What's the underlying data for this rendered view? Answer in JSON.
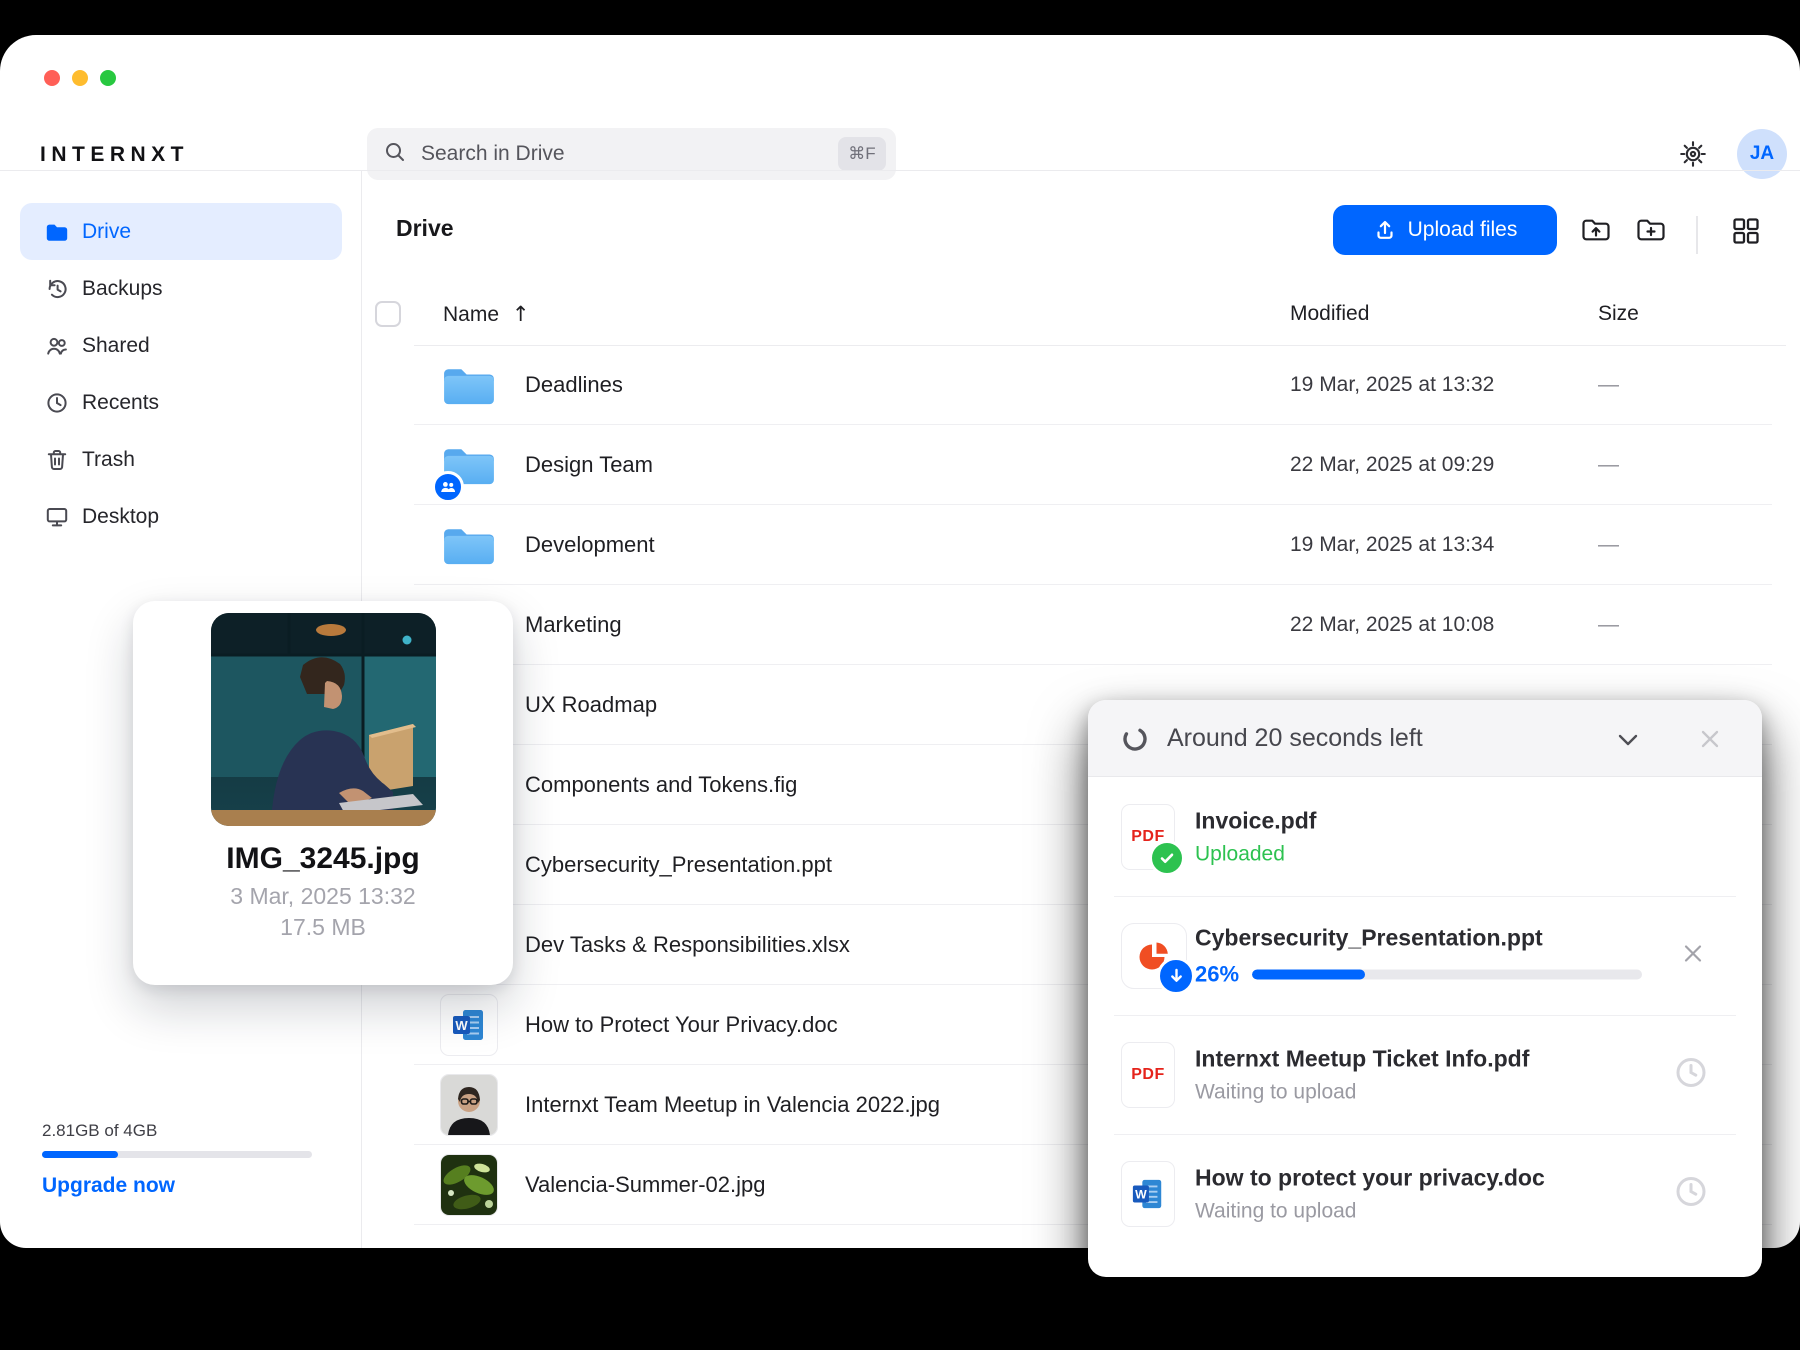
{
  "brand": {
    "logo_text": "INTERNXT"
  },
  "topbar": {
    "search_placeholder": "Search in Drive",
    "search_shortcut": "⌘F",
    "avatar_initials": "JA"
  },
  "sidebar": {
    "items": [
      {
        "label": "Drive",
        "active": true
      },
      {
        "label": "Backups",
        "active": false
      },
      {
        "label": "Shared",
        "active": false
      },
      {
        "label": "Recents",
        "active": false
      },
      {
        "label": "Trash",
        "active": false
      },
      {
        "label": "Desktop",
        "active": false
      }
    ],
    "storage": {
      "usage_text": "2.81GB of 4GB",
      "used_percent": 28,
      "upgrade_label": "Upgrade now"
    }
  },
  "content": {
    "title": "Drive",
    "upload_button_label": "Upload files",
    "table": {
      "col_name": "Name",
      "sort_indicator": "↑",
      "col_modified": "Modified",
      "col_size": "Size",
      "rows": [
        {
          "name": "Deadlines",
          "type": "folder",
          "modified": "19 Mar, 2025 at 13:32",
          "size": "—"
        },
        {
          "name": "Design Team",
          "type": "folder-shared",
          "modified": "22 Mar, 2025 at 09:29",
          "size": "—"
        },
        {
          "name": "Development",
          "type": "folder",
          "modified": "19 Mar, 2025 at 13:34",
          "size": "—"
        },
        {
          "name": "Marketing",
          "type": "folder",
          "modified": "22 Mar, 2025 at 10:08",
          "size": "—"
        },
        {
          "name": "UX Roadmap",
          "type": "folder"
        },
        {
          "name": "Components and Tokens.fig",
          "type": "file"
        },
        {
          "name": "Cybersecurity_Presentation.ppt",
          "type": "ppt"
        },
        {
          "name": "Dev Tasks & Responsibilities.xlsx",
          "type": "xlsx"
        },
        {
          "name": "How to Protect Your Privacy.doc",
          "type": "word"
        },
        {
          "name": "Internxt Team Meetup in Valencia 2022.jpg",
          "type": "image"
        },
        {
          "name": "Valencia-Summer-02.jpg",
          "type": "image"
        }
      ]
    }
  },
  "preview_card": {
    "filename": "IMG_3245.jpg",
    "date": "3 Mar, 2025 13:32",
    "size": "17.5 MB"
  },
  "upload_panel": {
    "title": "Around 20 seconds left",
    "items": [
      {
        "name": "Invoice.pdf",
        "type": "pdf",
        "status": "Uploaded",
        "state": "done"
      },
      {
        "name": "Cybersecurity_Presentation.ppt",
        "type": "ppt",
        "percent_label": "26%",
        "progress_percent": 29,
        "state": "uploading"
      },
      {
        "name": "Internxt Meetup Ticket Info.pdf",
        "type": "pdf",
        "status": "Waiting to upload",
        "state": "waiting"
      },
      {
        "name": "How to protect your privacy.doc",
        "type": "word",
        "status": "Waiting to upload",
        "state": "waiting"
      }
    ]
  },
  "colors": {
    "accent_blue": "#0066FF",
    "success_green": "#2DC250",
    "pdf_red": "#E5231B",
    "ppt_orange": "#F04E23",
    "word_blue": "#185ABD",
    "folder_blue": "#6FBCF5"
  }
}
